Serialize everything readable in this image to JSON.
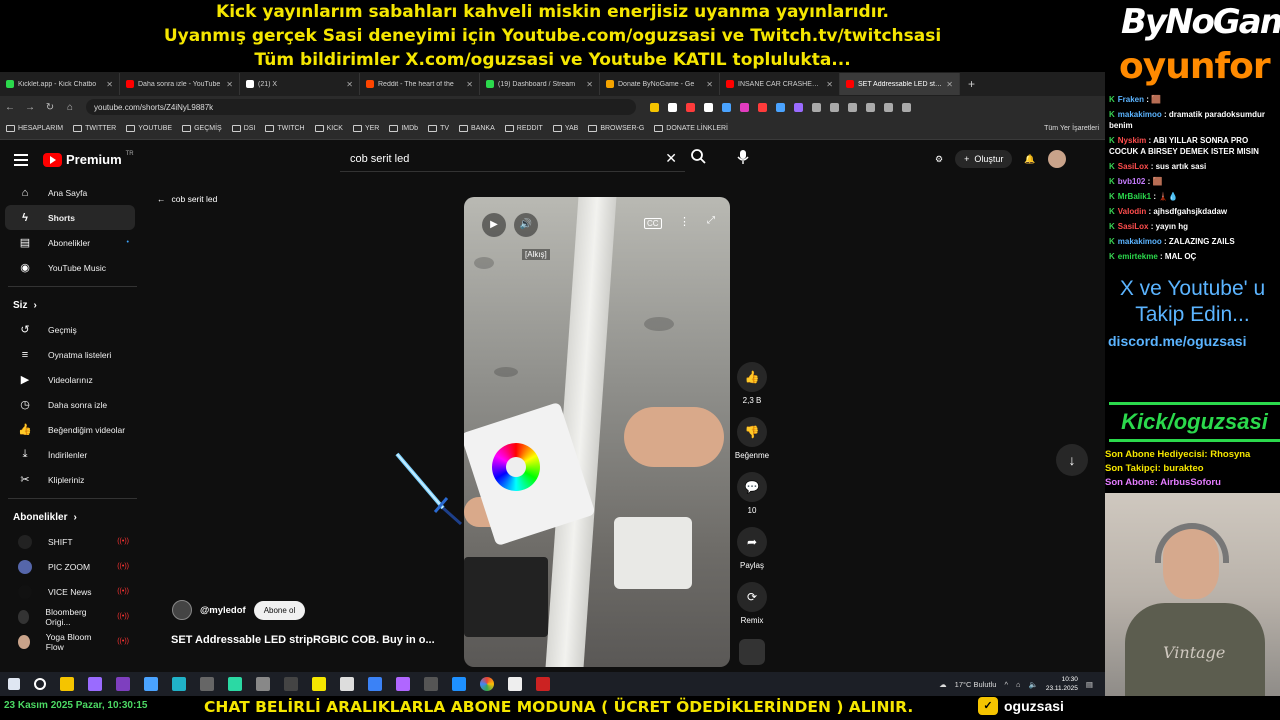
{
  "banner": {
    "line1": "Kick yayınlarım sabahları kahveli miskin enerjisiz uyanma yayınlarıdır.",
    "line2": "Uyanmış gerçek Sasi deneyimi için Youtube.com/oguzsasi ve Twitch.tv/twitchsasi",
    "line3": "Tüm bildirimler X.com/oguzsasi ve Youtube KATIL toplulukta..."
  },
  "browser": {
    "tabs": [
      {
        "label": "Kicklet.app - Kick Chatbo",
        "color": "#2bd94c"
      },
      {
        "label": "Daha sonra izle - YouTube",
        "color": "#ff0000"
      },
      {
        "label": "(21) X",
        "color": "#ffffff"
      },
      {
        "label": "Reddit - The heart of the",
        "color": "#ff4500"
      },
      {
        "label": "(19) Dashboard / Stream",
        "color": "#2bd94c"
      },
      {
        "label": "Donate ByNoGame - Ge",
        "color": "#f5a400"
      },
      {
        "label": "INSANE CAR CRASHES C",
        "color": "#ff0000"
      },
      {
        "label": "SET Addressable LED strip",
        "color": "#ff0000"
      }
    ],
    "active_tab_index": 7,
    "url": "youtube.com/shorts/Z4iNyL9887k",
    "bookmarks": [
      "HESAPLARIM",
      "TWITTER",
      "YOUTUBE",
      "GEÇMİŞ",
      "DSI",
      "TWITCH",
      "KICK",
      "YER",
      "IMDb",
      "TV",
      "BANKA",
      "REDDIT",
      "YAB",
      "BROWSER-G",
      "DONATE LİNKLERİ"
    ],
    "all_bookmarks": "Tüm Yer İşaretleri"
  },
  "youtube": {
    "logo_text": "Premium",
    "region": "TR",
    "search_value": "cob serit led",
    "create_label": "Oluştur",
    "back_label": "cob serit led",
    "sidebar": {
      "main": [
        {
          "label": "Ana Sayfa",
          "icon": "home-icon"
        },
        {
          "label": "Shorts",
          "icon": "shorts-icon"
        },
        {
          "label": "Abonelikler",
          "icon": "subscriptions-icon"
        },
        {
          "label": "YouTube Music",
          "icon": "music-icon"
        }
      ],
      "you_title": "Siz",
      "you": [
        {
          "label": "Geçmiş",
          "icon": "history-icon"
        },
        {
          "label": "Oynatma listeleri",
          "icon": "playlist-icon"
        },
        {
          "label": "Videolarınız",
          "icon": "your-videos-icon"
        },
        {
          "label": "Daha sonra izle",
          "icon": "watch-later-icon"
        },
        {
          "label": "Beğendiğim videolar",
          "icon": "liked-icon"
        },
        {
          "label": "İndirilenler",
          "icon": "download-icon"
        },
        {
          "label": "Klipleriniz",
          "icon": "clips-icon"
        }
      ],
      "subs_title": "Abonelikler",
      "subs": [
        {
          "label": "SHIFT",
          "color": "#222222"
        },
        {
          "label": "PIC ZOOM",
          "color": "#5566aa"
        },
        {
          "label": "VICE News",
          "color": "#111111"
        },
        {
          "label": "Bloomberg Origi...",
          "color": "#333333"
        },
        {
          "label": "Yoga Bloom Flow",
          "color": "#c9a38a"
        }
      ]
    },
    "video": {
      "caption": "[Alkış]",
      "channel": "@myledof",
      "subscribe_label": "Abone ol",
      "title": "SET Addressable LED stripRGBIC COB. Buy in o..."
    },
    "actions": {
      "likes": "2,3 B",
      "dislike": "Beğenme",
      "comments": "10",
      "share": "Paylaş",
      "remix": "Remix"
    }
  },
  "taskbar": {
    "weather": "17°C  Bulutlu",
    "time": "10:30",
    "date": "23.11.2025"
  },
  "bottom": {
    "datetime": "23 Kasım 2025 Pazar, 10:30:15",
    "message": "CHAT BELİRLİ ARALIKLARLA ABONE MODUNA ( ÜCRET ÖDEDİKLERİNDEN ) ALINIR.",
    "handle": "oguzsasi"
  },
  "panel": {
    "brand1": "ByNoGame",
    "brand2": "oyunfor",
    "chat": [
      {
        "user": "Fraken",
        "color": "#5bb4ff",
        "text": "🟫"
      },
      {
        "user": "makakimoo",
        "color": "#5bb4ff",
        "text": "dramatik paradoksumdur benim"
      },
      {
        "user": "Nyskim",
        "color": "#ff4d4d",
        "text": "ABI YILLAR SONRA PRO COCUK A BIRSEY DEMEK ISTER MISIN"
      },
      {
        "user": "SasiLox",
        "color": "#ff4d4d",
        "text": "sus artık sasi"
      },
      {
        "user": "bvb102",
        "color": "#c77dff",
        "text": "🟫"
      },
      {
        "user": "MrBalik1",
        "color": "#2bd94c",
        "text": "🗼💧"
      },
      {
        "user": "Valodin",
        "color": "#ff4d4d",
        "text": "ajhsdfgahsjkdadaw"
      },
      {
        "user": "SasiLox",
        "color": "#ff4d4d",
        "text": "yayın hg"
      },
      {
        "user": "makakimoo",
        "color": "#5bb4ff",
        "text": "ZALAZING ZAILS"
      },
      {
        "user": "emirtekme",
        "color": "#2bd94c",
        "text": "MAL OÇ"
      }
    ],
    "follow_text": "X ve Youtube' u Takip Edin...",
    "discord": "discord.me/oguzsasi",
    "kick": "Kick/oguzsasi",
    "last_gift": "Son Abone Hediyecisi: Rhosyna",
    "last_follower": "Son Takipçi: burakteo",
    "last_sub": "Son Abone: AirbusSoforu",
    "shirt_text": "Vintage"
  }
}
